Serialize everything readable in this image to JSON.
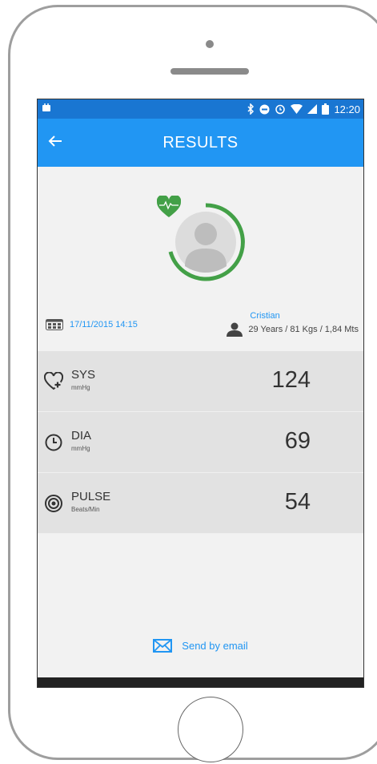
{
  "status_bar": {
    "time": "12:20"
  },
  "app_bar": {
    "title": "RESULTS"
  },
  "measurement": {
    "date": "17/11/2015 14:15"
  },
  "user": {
    "name": "Cristian",
    "details": "29 Years / 81 Kgs / 1,84 Mts"
  },
  "readings": [
    {
      "label": "SYS",
      "unit": "mmHg",
      "value": "124",
      "icon": "heart-plus-icon"
    },
    {
      "label": "DIA",
      "unit": "mmHg",
      "value": "69",
      "icon": "clock-icon"
    },
    {
      "label": "PULSE",
      "unit": "Beats/Min",
      "value": "54",
      "icon": "target-icon"
    }
  ],
  "actions": {
    "email_label": "Send by email"
  },
  "colors": {
    "primary": "#2196f3",
    "primary_dark": "#1976d2",
    "accent_green": "#43a047",
    "row_bg": "#e2e2e2"
  }
}
